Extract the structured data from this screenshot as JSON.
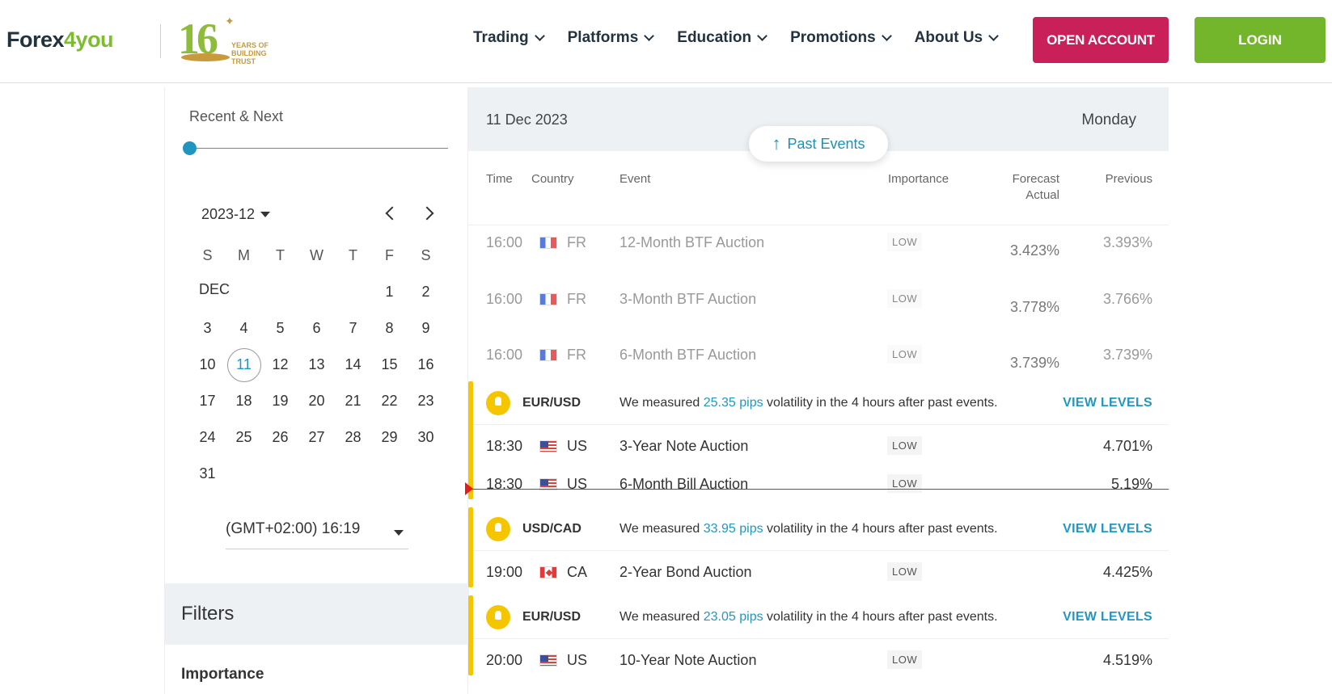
{
  "header": {
    "logo_text_a": "Forex",
    "logo_text_b": "4you",
    "badge_number": "16",
    "badge_line1": "YEARS OF",
    "badge_line2": "BUILDING",
    "badge_line3": "TRUST",
    "nav": [
      "Trading",
      "Platforms",
      "Education",
      "Promotions",
      "About Us"
    ],
    "open_account": "OPEN ACCOUNT",
    "login": "LOGIN"
  },
  "sidebar": {
    "recent_next": "Recent & Next",
    "month": "2023-12",
    "weekdays": [
      "S",
      "M",
      "T",
      "W",
      "T",
      "F",
      "S"
    ],
    "month_label": "DEC",
    "weeks": [
      [
        "",
        "",
        "",
        "",
        "",
        "1",
        "2"
      ],
      [
        "3",
        "4",
        "5",
        "6",
        "7",
        "8",
        "9"
      ],
      [
        "10",
        "11",
        "12",
        "13",
        "14",
        "15",
        "16"
      ],
      [
        "17",
        "18",
        "19",
        "20",
        "21",
        "22",
        "23"
      ],
      [
        "24",
        "25",
        "26",
        "27",
        "28",
        "29",
        "30"
      ],
      [
        "31",
        "",
        "",
        "",
        "",
        "",
        ""
      ]
    ],
    "selected_day": "11",
    "timezone": "(GMT+02:00) 16:19",
    "filters_title": "Filters",
    "importance_label": "Importance"
  },
  "calendar": {
    "date": "11 Dec 2023",
    "weekday": "Monday",
    "past_events": "Past Events",
    "columns": {
      "time": "Time",
      "country": "Country",
      "event": "Event",
      "importance": "Importance",
      "forecast": "Forecast",
      "actual": "Actual",
      "previous": "Previous"
    },
    "past_rows": [
      {
        "time": "16:00",
        "country": "FR",
        "event": "12-Month BTF Auction",
        "importance": "LOW",
        "actual": "3.423%",
        "previous": "3.393%"
      },
      {
        "time": "16:00",
        "country": "FR",
        "event": "3-Month BTF Auction",
        "importance": "LOW",
        "actual": "3.778%",
        "previous": "3.766%"
      },
      {
        "time": "16:00",
        "country": "FR",
        "event": "6-Month BTF Auction",
        "importance": "LOW",
        "actual": "3.739%",
        "previous": "3.739%"
      }
    ],
    "groups": [
      {
        "pair": "EUR/USD",
        "msg_pre": "We measured ",
        "pips": "25.35 pips",
        "msg_post": " volatility in the 4 hours after past events.",
        "link": "VIEW LEVELS",
        "rows": [
          {
            "time": "18:30",
            "country": "US",
            "event": "3-Year Note Auction",
            "importance": "LOW",
            "previous": "4.701%"
          },
          {
            "time": "18:30",
            "country": "US",
            "event": "6-Month Bill Auction",
            "importance": "LOW",
            "previous": "5.19%"
          }
        ]
      },
      {
        "pair": "USD/CAD",
        "msg_pre": "We measured ",
        "pips": "33.95 pips",
        "msg_post": " volatility in the 4 hours after past events.",
        "link": "VIEW LEVELS",
        "rows": [
          {
            "time": "19:00",
            "country": "CA",
            "event": "2-Year Bond Auction",
            "importance": "LOW",
            "previous": "4.425%"
          }
        ]
      },
      {
        "pair": "EUR/USD",
        "msg_pre": "We measured ",
        "pips": "23.05 pips",
        "msg_post": " volatility in the 4 hours after past events.",
        "link": "VIEW LEVELS",
        "rows": [
          {
            "time": "20:00",
            "country": "US",
            "event": "10-Year Note Auction",
            "importance": "LOW",
            "previous": "4.519%"
          }
        ]
      }
    ]
  }
}
